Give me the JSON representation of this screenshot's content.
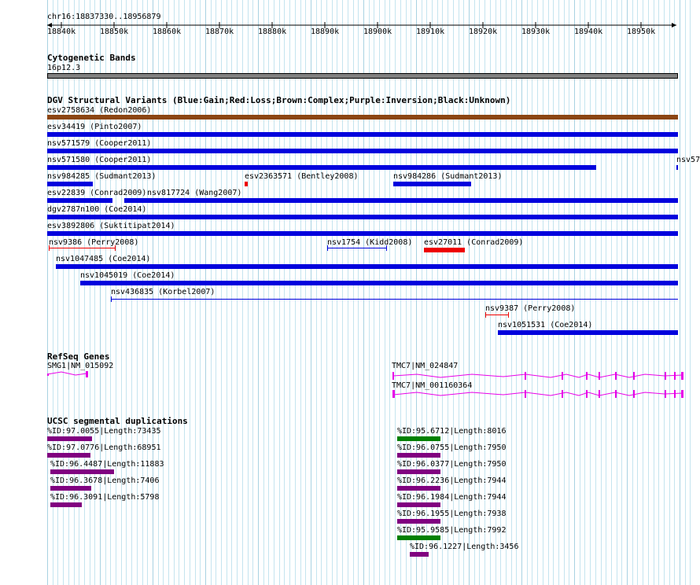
{
  "ruler": {
    "position": "chr16:18837330..18956879",
    "ticks": [
      "18840k",
      "18850k",
      "18860k",
      "18870k",
      "18880k",
      "18890k",
      "18900k",
      "18910k",
      "18920k",
      "18930k",
      "18940k",
      "18950k"
    ]
  },
  "cytoband": {
    "title": "Cytogenetic Bands",
    "band": "16p12.3",
    "color": "#808080"
  },
  "dgv": {
    "title": "DGV Structural Variants (Blue:Gain;Red:Loss;Brown:Complex;Purple:Inversion;Black:Unknown)",
    "colors": {
      "gain": "#0000dd",
      "loss": "#ee0000",
      "complex": "#8b4513"
    },
    "items": [
      {
        "label": "esv2758634 (Redon2006)",
        "type": "complex",
        "style": "thick"
      },
      {
        "label": "esv34419 (Pinto2007)",
        "type": "gain",
        "style": "thick"
      },
      {
        "label": "nsv571579 (Cooper2011)",
        "type": "gain",
        "style": "thick"
      },
      {
        "label": "nsv571580 (Cooper2011)",
        "type": "gain",
        "style": "thick"
      },
      {
        "label": "nsv57",
        "type": "gain",
        "style": "thick"
      },
      {
        "label": "nsv984285 (Sudmant2013)",
        "type": "gain",
        "style": "thick"
      },
      {
        "label": "esv2363571 (Bentley2008)",
        "type": "loss",
        "style": "thick"
      },
      {
        "label": "nsv984286 (Sudmant2013)",
        "type": "gain",
        "style": "thick"
      },
      {
        "label": "esv22839 (Conrad2009)",
        "type": "gain",
        "style": "thick"
      },
      {
        "label": "nsv817724 (Wang2007)",
        "type": "gain",
        "style": "thick"
      },
      {
        "label": "dgv2787n100 (Coe2014)",
        "type": "gain",
        "style": "thick"
      },
      {
        "label": "esv3892806 (Suktitipat2014)",
        "type": "gain",
        "style": "thick"
      },
      {
        "label": "nsv9386 (Perry2008)",
        "type": "loss",
        "style": "thin"
      },
      {
        "label": "nsv1754 (Kidd2008)",
        "type": "gain",
        "style": "thin"
      },
      {
        "label": "esv27011 (Conrad2009)",
        "type": "loss",
        "style": "thick"
      },
      {
        "label": "nsv1047485 (Coe2014)",
        "type": "gain",
        "style": "thick"
      },
      {
        "label": "nsv1045019 (Coe2014)",
        "type": "gain",
        "style": "thick"
      },
      {
        "label": "nsv436835 (Korbel2007)",
        "type": "gain",
        "style": "thin"
      },
      {
        "label": "nsv9387 (Perry2008)",
        "type": "loss",
        "style": "thin"
      },
      {
        "label": "nsv1051531 (Coe2014)",
        "type": "gain",
        "style": "thick"
      }
    ]
  },
  "refseq": {
    "title": "RefSeq Genes",
    "color": "#e800e8",
    "genes": [
      {
        "label": "SMG1|NM_015092"
      },
      {
        "label": "TMC7|NM_024847"
      },
      {
        "label": "TMC7|NM_001160364"
      }
    ]
  },
  "segdups": {
    "title": "UCSC segmental duplications",
    "colors": {
      "purple": "#800080",
      "green": "#008000"
    },
    "items": [
      {
        "label": "%ID:97.0055|Length:73435",
        "color": "purple"
      },
      {
        "label": "%ID:97.0776|Length:68951",
        "color": "purple"
      },
      {
        "label": "%ID:96.4487|Length:11883",
        "color": "purple"
      },
      {
        "label": "%ID:96.3678|Length:7406",
        "color": "purple"
      },
      {
        "label": "%ID:96.3091|Length:5798",
        "color": "purple"
      },
      {
        "label": "%ID:95.6712|Length:8016",
        "color": "green"
      },
      {
        "label": "%ID:96.0755|Length:7950",
        "color": "purple"
      },
      {
        "label": "%ID:96.0377|Length:7950",
        "color": "purple"
      },
      {
        "label": "%ID:96.2236|Length:7944",
        "color": "purple"
      },
      {
        "label": "%ID:96.1984|Length:7944",
        "color": "purple"
      },
      {
        "label": "%ID:96.1955|Length:7938",
        "color": "purple"
      },
      {
        "label": "%ID:95.9585|Length:7992",
        "color": "green"
      },
      {
        "label": "%ID:96.1227|Length:3456",
        "color": "purple"
      }
    ]
  }
}
